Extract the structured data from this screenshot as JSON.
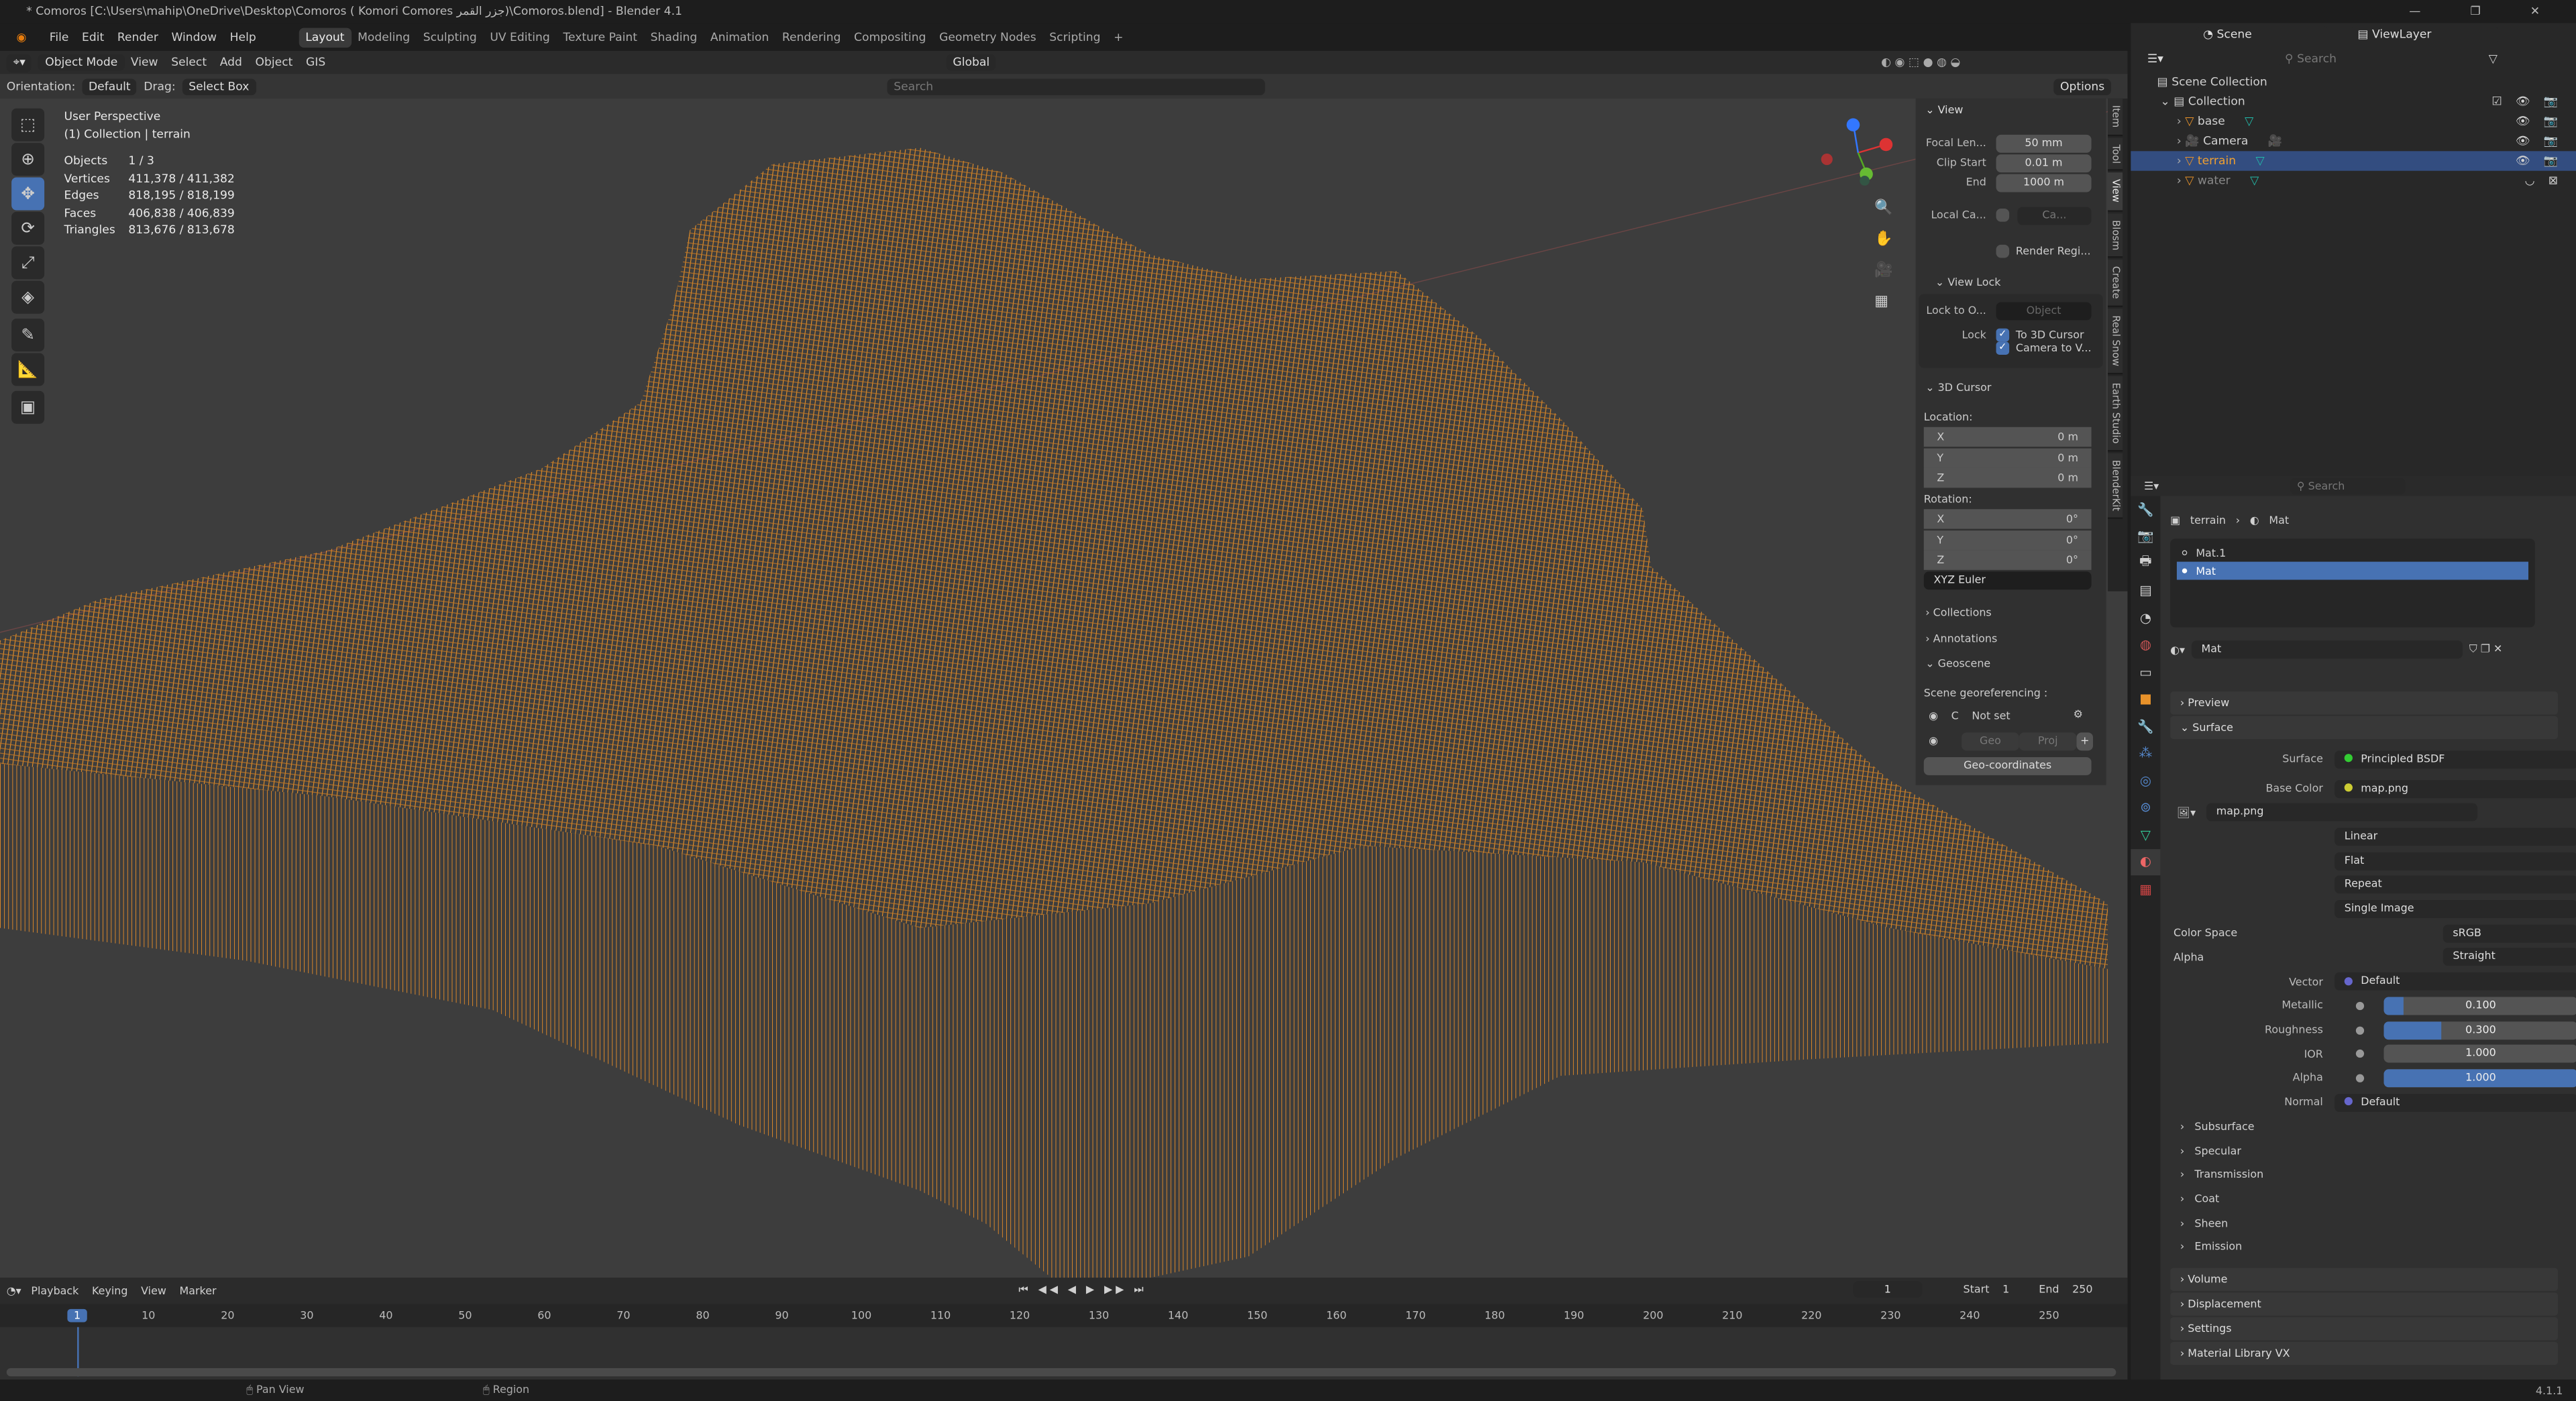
{
  "window": {
    "title": "* Comoros [C:\\Users\\mahip\\OneDrive\\Desktop\\Comoros ( Komori  Comores  جزر القمر)\\Comoros.blend] - Blender 4.1"
  },
  "menu": [
    "File",
    "Edit",
    "Render",
    "Window",
    "Help"
  ],
  "workspaces": [
    "Layout",
    "Modeling",
    "Sculpting",
    "UV Editing",
    "Texture Paint",
    "Shading",
    "Animation",
    "Rendering",
    "Compositing",
    "Geometry Nodes",
    "Scripting",
    "+"
  ],
  "viewport_header": {
    "mode": "Object Mode",
    "menus": [
      "View",
      "Select",
      "Add",
      "Object",
      "GIS"
    ],
    "transform": "Global",
    "orientation_label": "Orientation:",
    "orientation": "Default",
    "drag_label": "Drag:",
    "drag": "Select Box",
    "search_placeholder": "Search",
    "options": "Options"
  },
  "overlay": {
    "view": "User Perspective",
    "collection": "(1) Collection | terrain",
    "stats": [
      [
        "Objects",
        "1 / 3"
      ],
      [
        "Vertices",
        "411,378 / 411,382"
      ],
      [
        "Edges",
        "818,195 / 818,199"
      ],
      [
        "Faces",
        "406,838 / 406,839"
      ],
      [
        "Triangles",
        "813,676 / 813,678"
      ]
    ]
  },
  "colors": {
    "wire": "#e8922a",
    "accent": "#4772b3",
    "bg": "#3d3d3d"
  },
  "npanel": {
    "view_title": "View",
    "focal_label": "Focal Len...",
    "focal": "50 mm",
    "clip_start_label": "Clip Start",
    "clip_start": "0.01 m",
    "clip_end_label": "End",
    "clip_end": "1000 m",
    "local_cam_label": "Local Ca...",
    "local_cam": "Ca...",
    "render_region": "Render Regi...",
    "view_lock": "View Lock",
    "lock_to_label": "Lock to O...",
    "lock_to": "Object",
    "lock_label": "Lock",
    "lock_cursor": "To 3D Cursor",
    "lock_camera": "Camera to V...",
    "cursor_title": "3D Cursor",
    "location_label": "Location:",
    "loc": [
      [
        "X",
        "0 m"
      ],
      [
        "Y",
        "0 m"
      ],
      [
        "Z",
        "0 m"
      ]
    ],
    "rotation_label": "Rotation:",
    "rot": [
      [
        "X",
        "0°"
      ],
      [
        "Y",
        "0°"
      ],
      [
        "Z",
        "0°"
      ]
    ],
    "rot_mode": "XYZ Euler",
    "collections": "Collections",
    "annotations": "Annotations",
    "geoscene": "Geoscene",
    "georef_label": "Scene georeferencing :",
    "crs": "C",
    "not_set": "Not set",
    "geo": "Geo",
    "proj": "Proj",
    "geo_coords": "Geo-coordinates",
    "tabs": [
      "Item",
      "Tool",
      "View",
      "Blosm",
      "Create",
      "Real Snow",
      "Earth Studio",
      "BlenderKit"
    ]
  },
  "outliner": {
    "scene": "Scene",
    "view_layer": "ViewLayer",
    "search_placeholder": "Search",
    "scene_collection": "Scene Collection",
    "collection": "Collection",
    "items": [
      "base",
      "Camera",
      "terrain",
      "water"
    ]
  },
  "properties": {
    "search_placeholder": "Search",
    "breadcrumb_obj": "terrain",
    "breadcrumb_mat": "Mat",
    "slots": [
      "Mat.1",
      "Mat"
    ],
    "material": "Mat",
    "sections": {
      "preview": "Preview",
      "surface": "Surface"
    },
    "surface_label": "Surface",
    "surface": "Principled BSDF",
    "base_color_label": "Base Color",
    "base_color": "map.png",
    "image": "map.png",
    "interp": "Linear",
    "proj": "Flat",
    "ext": "Repeat",
    "source": "Single Image",
    "color_space_label": "Color Space",
    "color_space": "sRGB",
    "alpha_mode_label": "Alpha",
    "alpha_mode": "Straight",
    "vector_label": "Vector",
    "vector": "Default",
    "normal_label": "Normal",
    "normal": "Default",
    "sliders": [
      {
        "label": "Metallic",
        "value": 0.1,
        "text": "0.100",
        "fill": 0.1
      },
      {
        "label": "Roughness",
        "value": 0.3,
        "text": "0.300",
        "fill": 0.3
      },
      {
        "label": "IOR",
        "value": 1.0,
        "text": "1.000",
        "fill": 0
      },
      {
        "label": "Alpha",
        "value": 1.0,
        "text": "1.000",
        "fill": 1.0
      }
    ],
    "subpanels": [
      "Subsurface",
      "Specular",
      "Transmission",
      "Coat",
      "Sheen",
      "Emission"
    ],
    "bottom_sections": [
      "Volume",
      "Displacement",
      "Settings",
      "Material Library VX"
    ]
  },
  "timeline": {
    "menus": [
      "Playback",
      "Keying",
      "View",
      "Marker"
    ],
    "current": "1",
    "start_label": "Start",
    "start": "1",
    "end_label": "End",
    "end": "250",
    "ticks": [
      "1",
      "10",
      "20",
      "30",
      "40",
      "50",
      "60",
      "70",
      "80",
      "90",
      "100",
      "110",
      "120",
      "130",
      "140",
      "150",
      "160",
      "170",
      "180",
      "190",
      "200",
      "210",
      "220",
      "230",
      "240",
      "250"
    ]
  },
  "status": {
    "pan": "Pan View",
    "region": "Region",
    "version": "4.1.1"
  }
}
